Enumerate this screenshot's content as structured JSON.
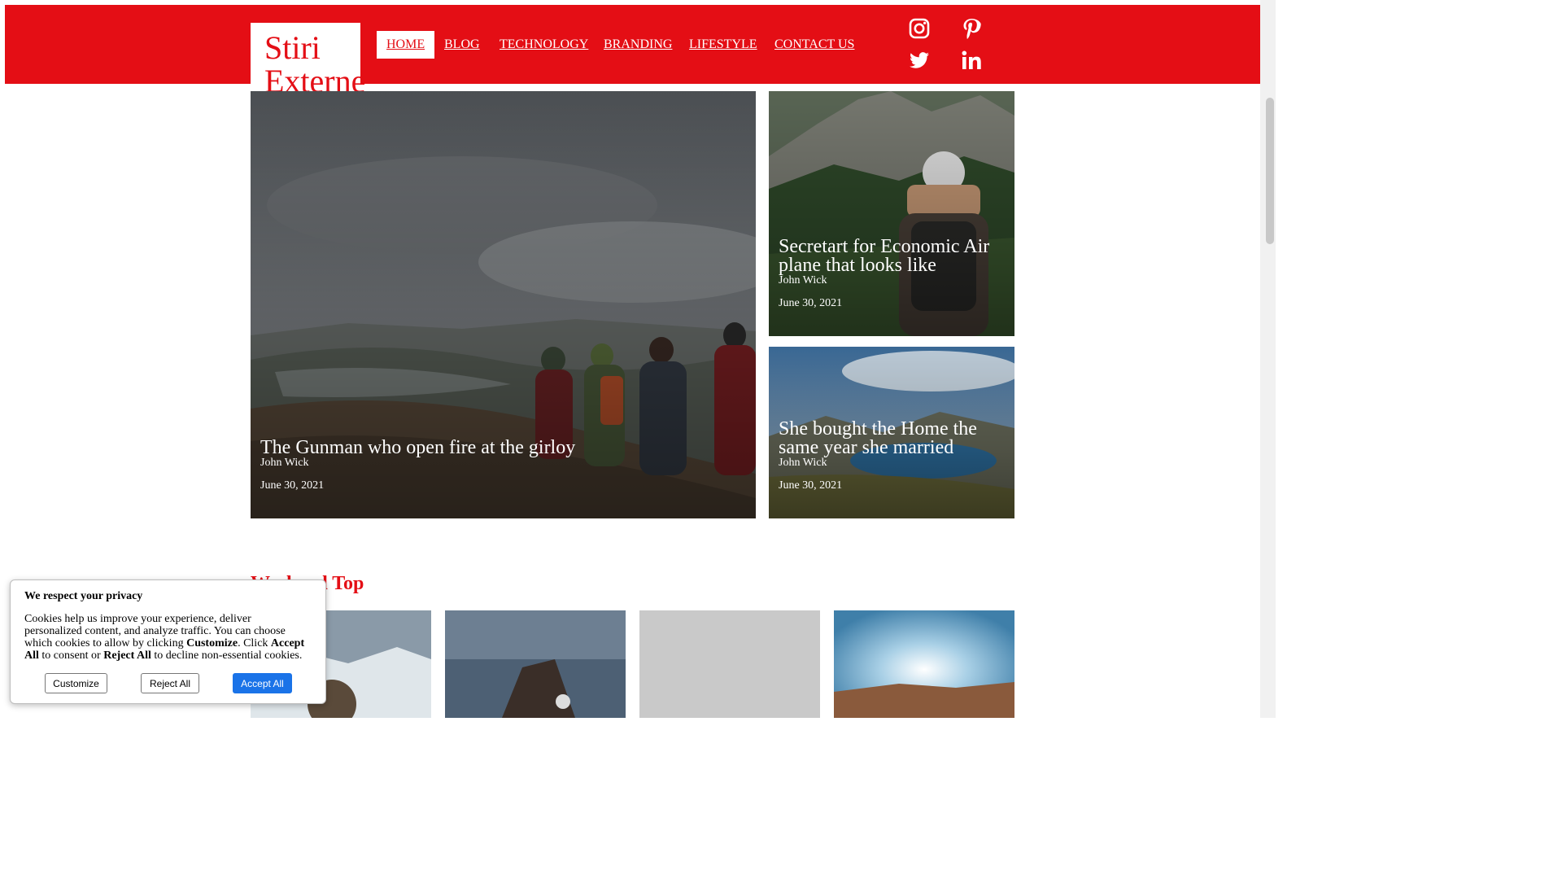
{
  "site": {
    "logo_line1": "Stiri",
    "logo_line2": "Externe",
    "brand_color": "#e40e15"
  },
  "nav": {
    "items": [
      {
        "label": "HOME",
        "active": true
      },
      {
        "label": "BLOG"
      },
      {
        "label": "TECHNOLOGY"
      },
      {
        "label": "BRANDING"
      },
      {
        "label": "LIFESTYLE"
      },
      {
        "label": "CONTACT US"
      }
    ]
  },
  "social": {
    "icons": [
      "instagram-icon",
      "pinterest-icon",
      "twitter-icon",
      "linkedin-icon"
    ]
  },
  "featured": {
    "main": {
      "title": "The Gunman who open fire at the girloy",
      "author": "John Wick",
      "date": "June 30, 2021"
    },
    "side1": {
      "title_line1": "Secretart for Economic Air",
      "title_line2": "plane that looks like",
      "author": "John Wick",
      "date": "June 30, 2021"
    },
    "side2": {
      "title_line1": "She bought the Home the",
      "title_line2": "same year she married",
      "author": "John Wick",
      "date": "June 30, 2021"
    }
  },
  "weekend": {
    "title": "Weekend Top"
  },
  "cookie": {
    "heading": "We respect your privacy",
    "text_part1": "Cookies help us improve your experience, deliver personalized content, and analyze traffic. You can choose which cookies to allow by clicking ",
    "text_bold1": "Customize",
    "text_part2": ". Click ",
    "text_bold2": "Accept All",
    "text_part3": " to consent or ",
    "text_bold3": "Reject All",
    "text_part4": " to decline non-essential cookies.",
    "customize_label": "Customize",
    "reject_label": "Reject All",
    "accept_label": "Accept All"
  }
}
